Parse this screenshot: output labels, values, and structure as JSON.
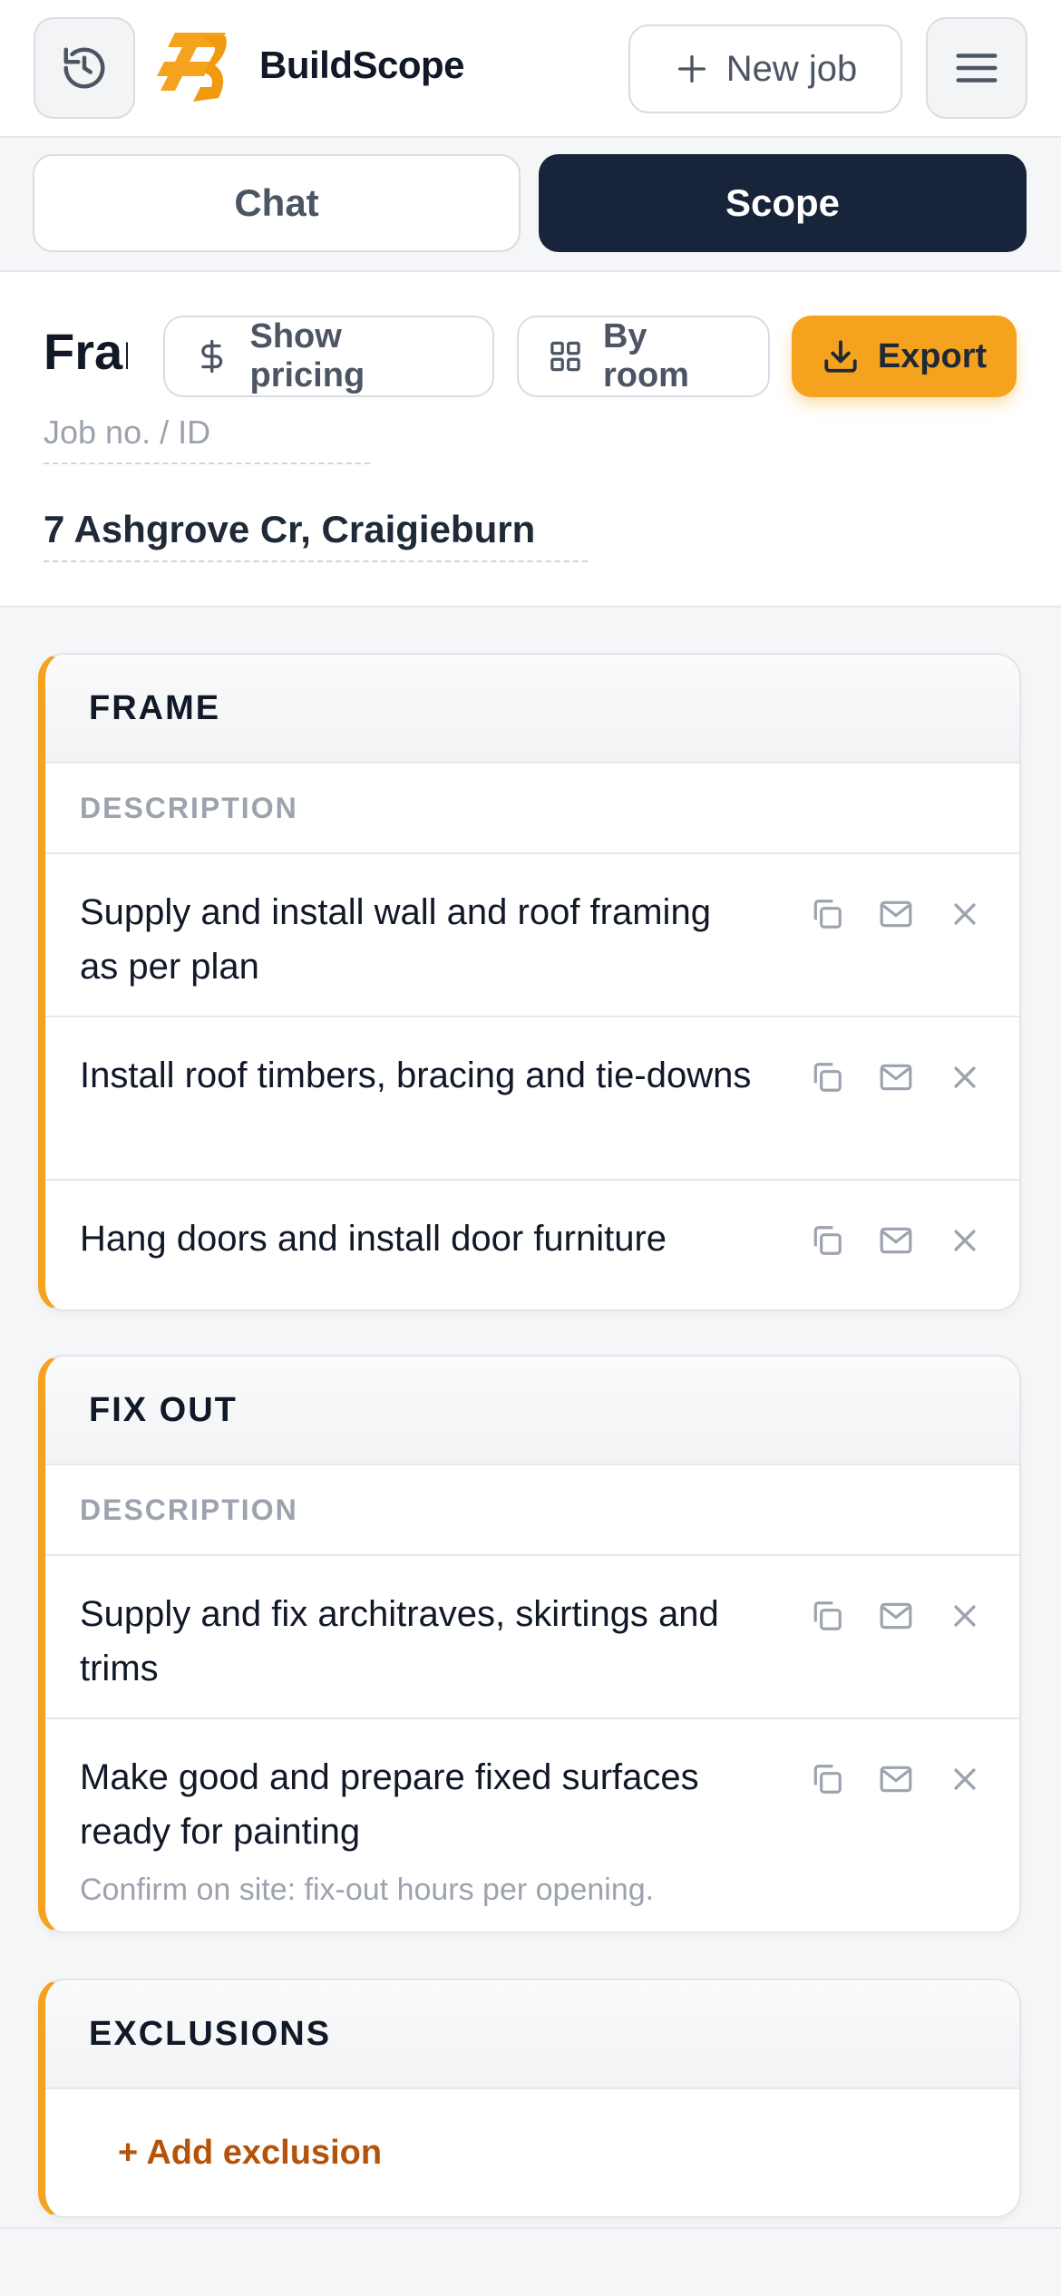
{
  "header": {
    "brand": "BuildScope",
    "new_job_label": "New job",
    "icons": {
      "history": "history-icon",
      "menu": "menu-icon",
      "logo": "buildscope-logo",
      "plus": "plus-icon"
    }
  },
  "tabs": [
    {
      "label": "Chat",
      "active": false
    },
    {
      "label": "Scope",
      "active": true
    }
  ],
  "job": {
    "title": "Frame",
    "show_pricing_label": "Show pricing",
    "by_room_label": "By room",
    "export_label": "Export",
    "job_no_placeholder": "Job no. / ID",
    "address": "7 Ashgrove Cr, Craigieburn"
  },
  "sections": [
    {
      "title": "FRAME",
      "column": "DESCRIPTION",
      "items": [
        {
          "text": "Supply and install wall and roof framing as per plan",
          "note": ""
        },
        {
          "text": "Install roof timbers, bracing and tie-downs",
          "note": ""
        },
        {
          "text": "Hang doors and install door furniture",
          "note": ""
        }
      ]
    },
    {
      "title": "FIX OUT",
      "column": "DESCRIPTION",
      "items": [
        {
          "text": "Supply and fix architraves, skirtings and trims",
          "note": ""
        },
        {
          "text": "Make good and prepare fixed surfaces ready for painting",
          "note": "Confirm on site: fix-out hours per opening."
        }
      ]
    },
    {
      "title": "EXCLUSIONS",
      "add_label": "+ Add exclusion"
    }
  ],
  "colors": {
    "accent": "#f5a21f",
    "dark": "#17243a",
    "link": "#b45309"
  }
}
